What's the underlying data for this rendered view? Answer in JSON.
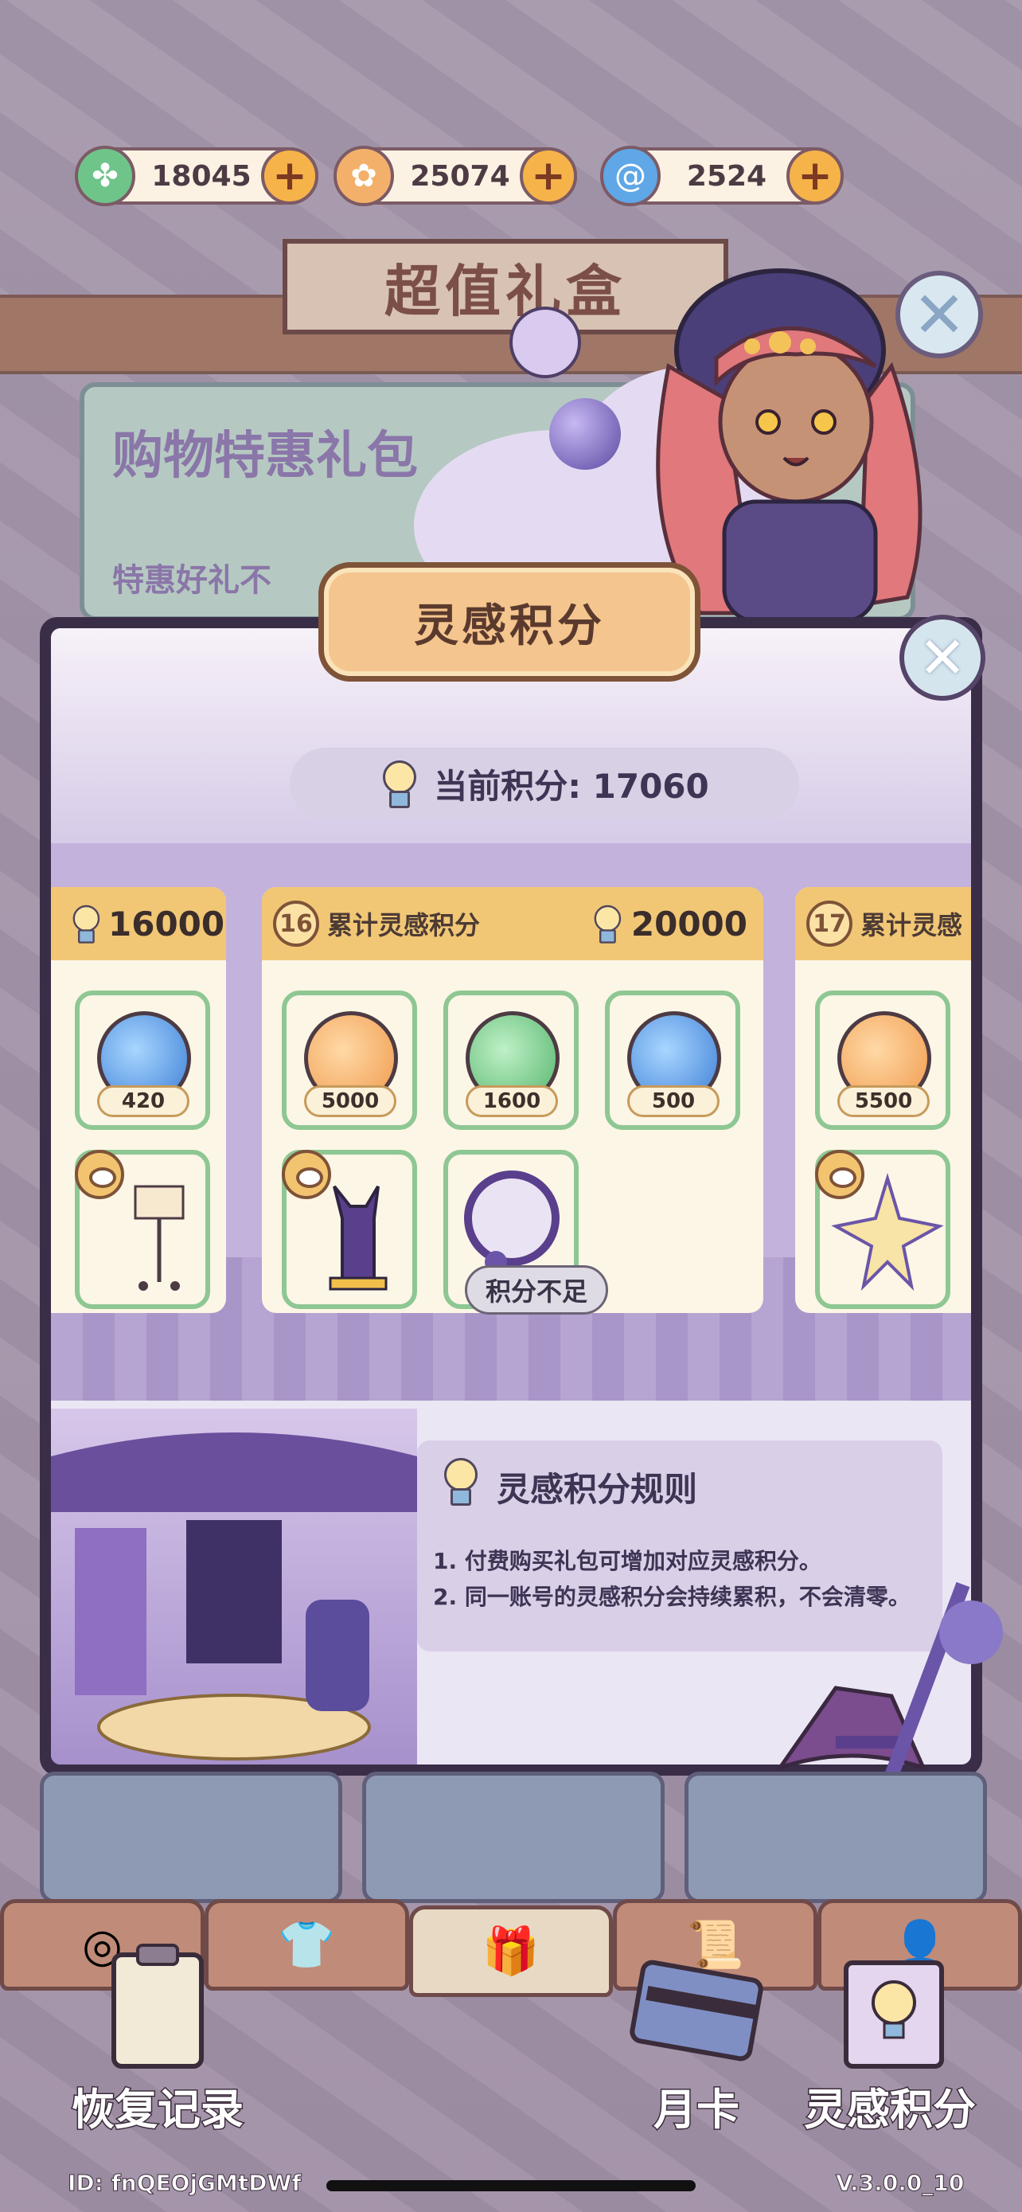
{
  "currencies": [
    {
      "name": "clover",
      "icon": "clover-icon",
      "value": "18045",
      "color": "#6fc48a"
    },
    {
      "name": "token",
      "icon": "coin-icon",
      "value": "25074",
      "color": "#f3b06a"
    },
    {
      "name": "orb",
      "icon": "spiral-orb-icon",
      "value": "2524",
      "color": "#5fa7e6"
    }
  ],
  "plus_symbol": "+",
  "background": {
    "banner_title": "超值礼盒",
    "card_title": "购物特惠礼包",
    "card_subtitle": "特惠好礼不"
  },
  "modal": {
    "title": "灵感积分",
    "current_points": "当前积分: 17060",
    "close_symbol": "✕",
    "insufficient_button": "积分不足"
  },
  "tiers": [
    {
      "number": "",
      "label": "",
      "points": "16000",
      "items": [
        {
          "icon": "spiral-orb-icon",
          "qty": "420"
        }
      ]
    },
    {
      "number": "16",
      "label": "累计灵感积分",
      "points": "20000",
      "items": [
        {
          "icon": "coin-icon",
          "qty": "5000"
        },
        {
          "icon": "clover-icon",
          "qty": "1600"
        },
        {
          "icon": "spiral-orb-icon",
          "qty": "500"
        }
      ]
    },
    {
      "number": "17",
      "label": "累计灵感",
      "points": "",
      "items": [
        {
          "icon": "coin-icon",
          "qty": "5500"
        }
      ]
    }
  ],
  "rules": {
    "title": "灵感积分规则",
    "lines": [
      "1. 付费购买礼包可增加对应灵感积分。",
      "2. 同一账号的灵感积分会持续累积，不会清零。"
    ]
  },
  "tabs": [
    {
      "icon": "spiral-icon",
      "glyph": "◎"
    },
    {
      "icon": "shirt-icon",
      "glyph": "👕"
    },
    {
      "icon": "gift-icon",
      "glyph": "🎁"
    },
    {
      "icon": "scroll-icon",
      "glyph": "📜"
    },
    {
      "icon": "person-icon",
      "glyph": "👤"
    }
  ],
  "bottom": {
    "restore": "恢复记录",
    "monthly_card": "月卡",
    "points": "灵感积分",
    "id_text": "ID: fnQEOjGMtDWf",
    "version": "V.3.0.0_10"
  }
}
